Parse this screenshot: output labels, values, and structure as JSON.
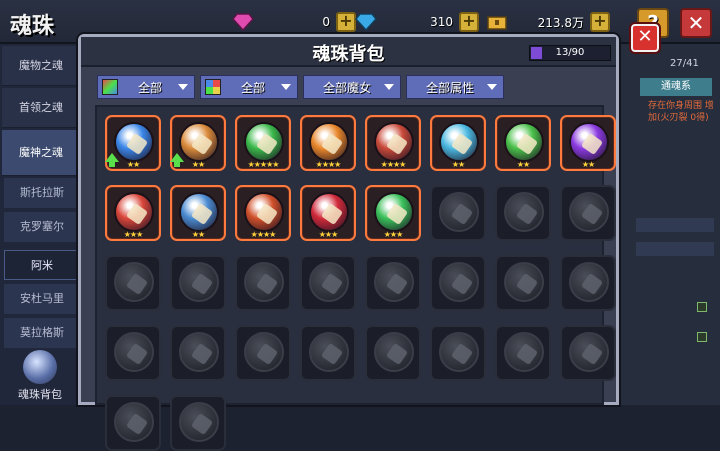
{
  "header": {
    "title": "魂珠",
    "resources": [
      {
        "icon": "pink-gem-icon",
        "value": "0",
        "color": "#e04bb0"
      },
      {
        "icon": "blue-gem-icon",
        "value": "310",
        "color": "#3aa9e8"
      },
      {
        "icon": "gold-chest-icon",
        "value": "213.8万",
        "color": "#e8b23a"
      }
    ],
    "help_label": "?",
    "close_label": "✕"
  },
  "sidebar": {
    "items": [
      {
        "label": "魔物之魂"
      },
      {
        "label": "首领之魂"
      },
      {
        "label": "魔神之魂"
      }
    ],
    "subitems": [
      {
        "label": "斯托拉斯"
      },
      {
        "label": "克罗塞尔"
      },
      {
        "label": "阿米"
      },
      {
        "label": "安杜马里"
      },
      {
        "label": "莫拉格斯"
      }
    ],
    "bag_label": "魂珠背包"
  },
  "rightpanel": {
    "count": "27/41",
    "tag": "通魂系",
    "text": "存在你身周围 增加(火刃裂 0得)"
  },
  "dialog": {
    "title": "魂珠背包",
    "capacity": "13/90",
    "capacity_fraction": 0.144,
    "close_label": "✕",
    "filters": [
      {
        "label": "全部",
        "icon": "rainbow-type-icon"
      },
      {
        "label": "全部",
        "icon": "color-grid-icon"
      },
      {
        "label": "全部魔女",
        "icon": ""
      },
      {
        "label": "全部属性",
        "icon": ""
      }
    ],
    "slots": [
      {
        "owned": true,
        "color": "#3b86e8",
        "stars": "★★",
        "upgrade": true
      },
      {
        "owned": true,
        "color": "#d98a3a",
        "stars": "★★",
        "upgrade": true
      },
      {
        "owned": true,
        "color": "#3ab84a",
        "stars": "★★★★★",
        "upgrade": false
      },
      {
        "owned": true,
        "color": "#e8862a",
        "stars": "★★★★",
        "upgrade": false
      },
      {
        "owned": true,
        "color": "#c94a3a",
        "stars": "★★★★",
        "upgrade": false
      },
      {
        "owned": true,
        "color": "#4ab8e0",
        "stars": "★★",
        "upgrade": false
      },
      {
        "owned": true,
        "color": "#4ac04a",
        "stars": "★★",
        "upgrade": false
      },
      {
        "owned": true,
        "color": "#8a3ae0",
        "stars": "★★",
        "upgrade": false
      },
      {
        "owned": true,
        "color": "#d9463a",
        "stars": "★★★",
        "upgrade": false
      },
      {
        "owned": true,
        "color": "#4a8ad0",
        "stars": "★★",
        "upgrade": false
      },
      {
        "owned": true,
        "color": "#d0502a",
        "stars": "★★★★",
        "upgrade": false
      },
      {
        "owned": true,
        "color": "#d02a3a",
        "stars": "★★★",
        "upgrade": false
      },
      {
        "owned": true,
        "color": "#3ac05a",
        "stars": "★★★",
        "upgrade": false
      },
      {
        "owned": false
      },
      {
        "owned": false
      },
      {
        "owned": false
      },
      {
        "owned": false
      },
      {
        "owned": false
      },
      {
        "owned": false
      },
      {
        "owned": false
      },
      {
        "owned": false
      },
      {
        "owned": false
      },
      {
        "owned": false
      },
      {
        "owned": false
      },
      {
        "owned": false
      },
      {
        "owned": false
      },
      {
        "owned": false
      },
      {
        "owned": false
      },
      {
        "owned": false
      },
      {
        "owned": false
      },
      {
        "owned": false
      },
      {
        "owned": false
      },
      {
        "owned": false
      },
      {
        "owned": false
      }
    ]
  }
}
